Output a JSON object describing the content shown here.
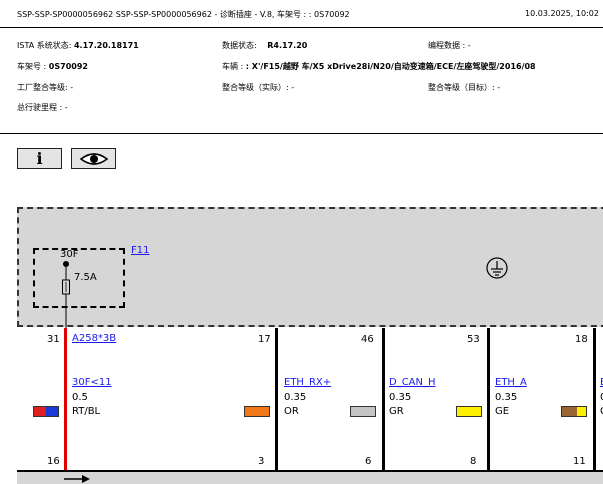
{
  "header": {
    "title": "SSP-SSP-SP0000056962  SSP-SSP-SP0000056962  - 诊断插座 - V.8, 车架号 : : 0S70092",
    "datetime": "10.03.2025,  10:02"
  },
  "info": {
    "ista_label": "ISTA 系统状态:",
    "ista_value": "4.17.20.18171",
    "data_label": "数据状态:",
    "data_value": "R4.17.20",
    "prog_label": "编程数据 : -",
    "vin_label": "车架号 :",
    "vin_value": "0S70092",
    "vehicle_label": "车辆 :",
    "vehicle_value": ": X'/F15/越野 车/X5 xDrive28i/N20/自动变速箱/ECE/左座驾驶型/2016/08",
    "plant_label": "工厂整合等级: -",
    "level_actual_label": "整合等级（实际）: -",
    "level_target_label": "整合等级（目标）: -",
    "mileage_label": "总行驶里程 : -"
  },
  "toolbar": {
    "info_glyph": "i",
    "eye_icon": "eye-icon"
  },
  "fuse": {
    "name": "30F",
    "rating": "7.5A",
    "box_link": "F11"
  },
  "connectors": [
    {
      "top_pin": "31",
      "link": "A258*3B",
      "wire_link": "30F<11",
      "size": "0.5",
      "color_code": "RT/BL",
      "bottom_pin": "16",
      "swatch": [
        "#e02020",
        "#1a3ad6"
      ]
    },
    {
      "top_pin": "17",
      "wire_link": "ETH_RX+",
      "size": "0.35",
      "color_code": "OR",
      "bottom_pin": "3",
      "swatch": [
        "#f07818",
        "#f07818"
      ]
    },
    {
      "top_pin": "46",
      "wire_link": "D_CAN_H",
      "size": "0.35",
      "color_code": "GR",
      "bottom_pin": "6",
      "swatch": [
        "#c4c4c4",
        "#c4c4c4"
      ]
    },
    {
      "top_pin": "53",
      "wire_link": "ETH_A",
      "size": "0.35",
      "color_code": "GE",
      "bottom_pin": "8",
      "swatch": [
        "#ffef00",
        "#ffef00"
      ]
    },
    {
      "top_pin": "18",
      "wire_link": "E",
      "size": "0",
      "color_code": "G",
      "bottom_pin": "11",
      "swatch": [
        "#9a6530",
        "#ffef00"
      ]
    }
  ],
  "colors": {
    "red_wire": "#e00000",
    "black_wire": "#000000",
    "fuse_area_bg": "#d6d6d6",
    "link": "#1a1aee"
  }
}
